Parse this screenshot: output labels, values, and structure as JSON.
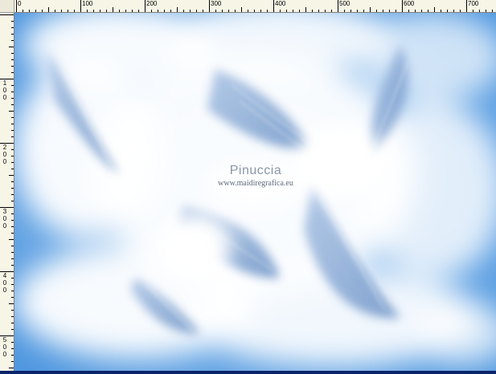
{
  "ruler": {
    "top_labels": [
      "0",
      "100",
      "200",
      "300",
      "400",
      "500",
      "600",
      "700"
    ],
    "left_labels": [
      "1\n0\n0",
      "2\n0\n0",
      "3\n0\n0",
      "4\n0\n0",
      "5\n0\n0"
    ]
  },
  "watermark": {
    "name": "Pinuccia",
    "url": "www.maidiregrafica.eu"
  },
  "colors": {
    "sky": "#5b9fe2",
    "cloud": "#ffffff",
    "wing_tint": "#7fa3cf",
    "ruler_bg": "#f7f5e6",
    "taskbar": "#0a246a"
  }
}
